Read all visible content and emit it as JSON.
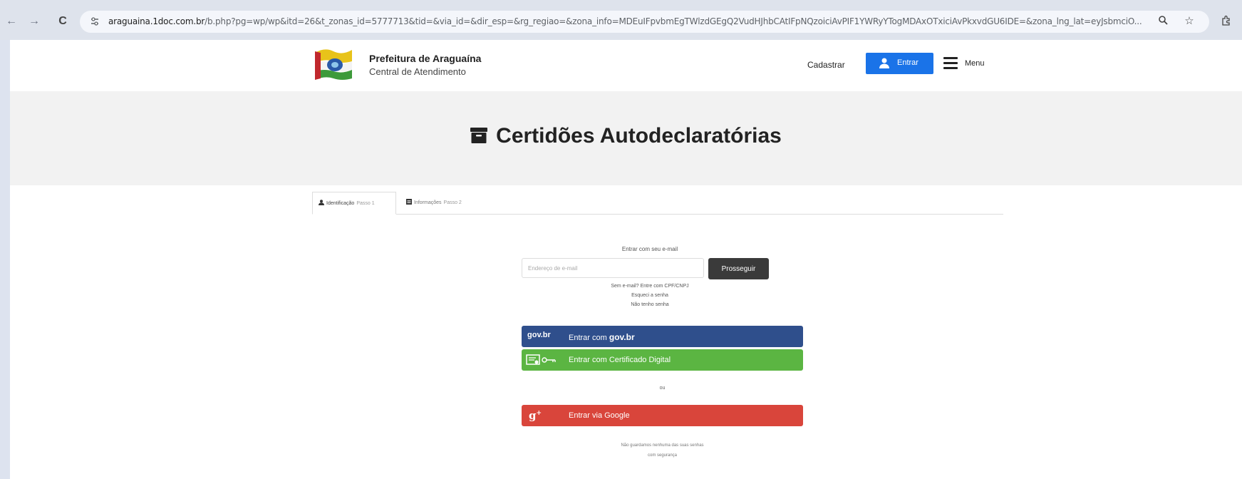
{
  "browser": {
    "back_icon": "←",
    "forward_icon": "→",
    "reload_icon": "C",
    "url_host": "araguaina.1doc.com.br",
    "url_rest": "/b.php?pg=wp/wp&itd=26&t_zonas_id=5777713&tid=&via_id=&dir_esp=&rg_regiao=&zona_info=MDEuIFpvbmEgTWlzdGEgQ2VudHJhbCAtIFpNQzoiciAvPIF1YWRyYTogMDAxOTxiciAvPkxvdGU6IDE=&zona_lng_lat=eyJsbmciO..."
  },
  "header": {
    "title": "Prefeitura de Araguaína",
    "subtitle": "Central de Atendimento",
    "register_label": "Cadastrar",
    "login_label": "Entrar",
    "menu_label": "Menu"
  },
  "hero": {
    "title": "Certidões Autodeclaratórias"
  },
  "tabs": [
    {
      "label": "Identificação",
      "step": "Passo 1"
    },
    {
      "label": "Informações",
      "step": "Passo 2"
    }
  ],
  "login": {
    "email_title": "Entrar com seu e-mail",
    "email_placeholder": "Endereço de e-mail",
    "continue_label": "Prosseguir",
    "link_no_email": "Sem e-mail? Entre com CPF/CNPJ",
    "link_forgot": "Esqueci a senha",
    "link_no_password": "Não tenho senha",
    "govbr_logo": "gov.br",
    "govbr_label_prefix": "Entrar com ",
    "govbr_label_brand": "gov.br",
    "cert_label": "Entrar com Certificado Digital",
    "or_label": "ou",
    "google_label": "Entrar via Google",
    "footnote_1": "Não guardamos nenhuma das suas senhas",
    "footnote_2": "com segurança"
  },
  "colors": {
    "primary_blue": "#1a73e8",
    "govbr_blue": "#2f4f8c",
    "cert_green": "#5bb542",
    "google_red": "#d9453b",
    "dark_button": "#3a3a3a"
  }
}
